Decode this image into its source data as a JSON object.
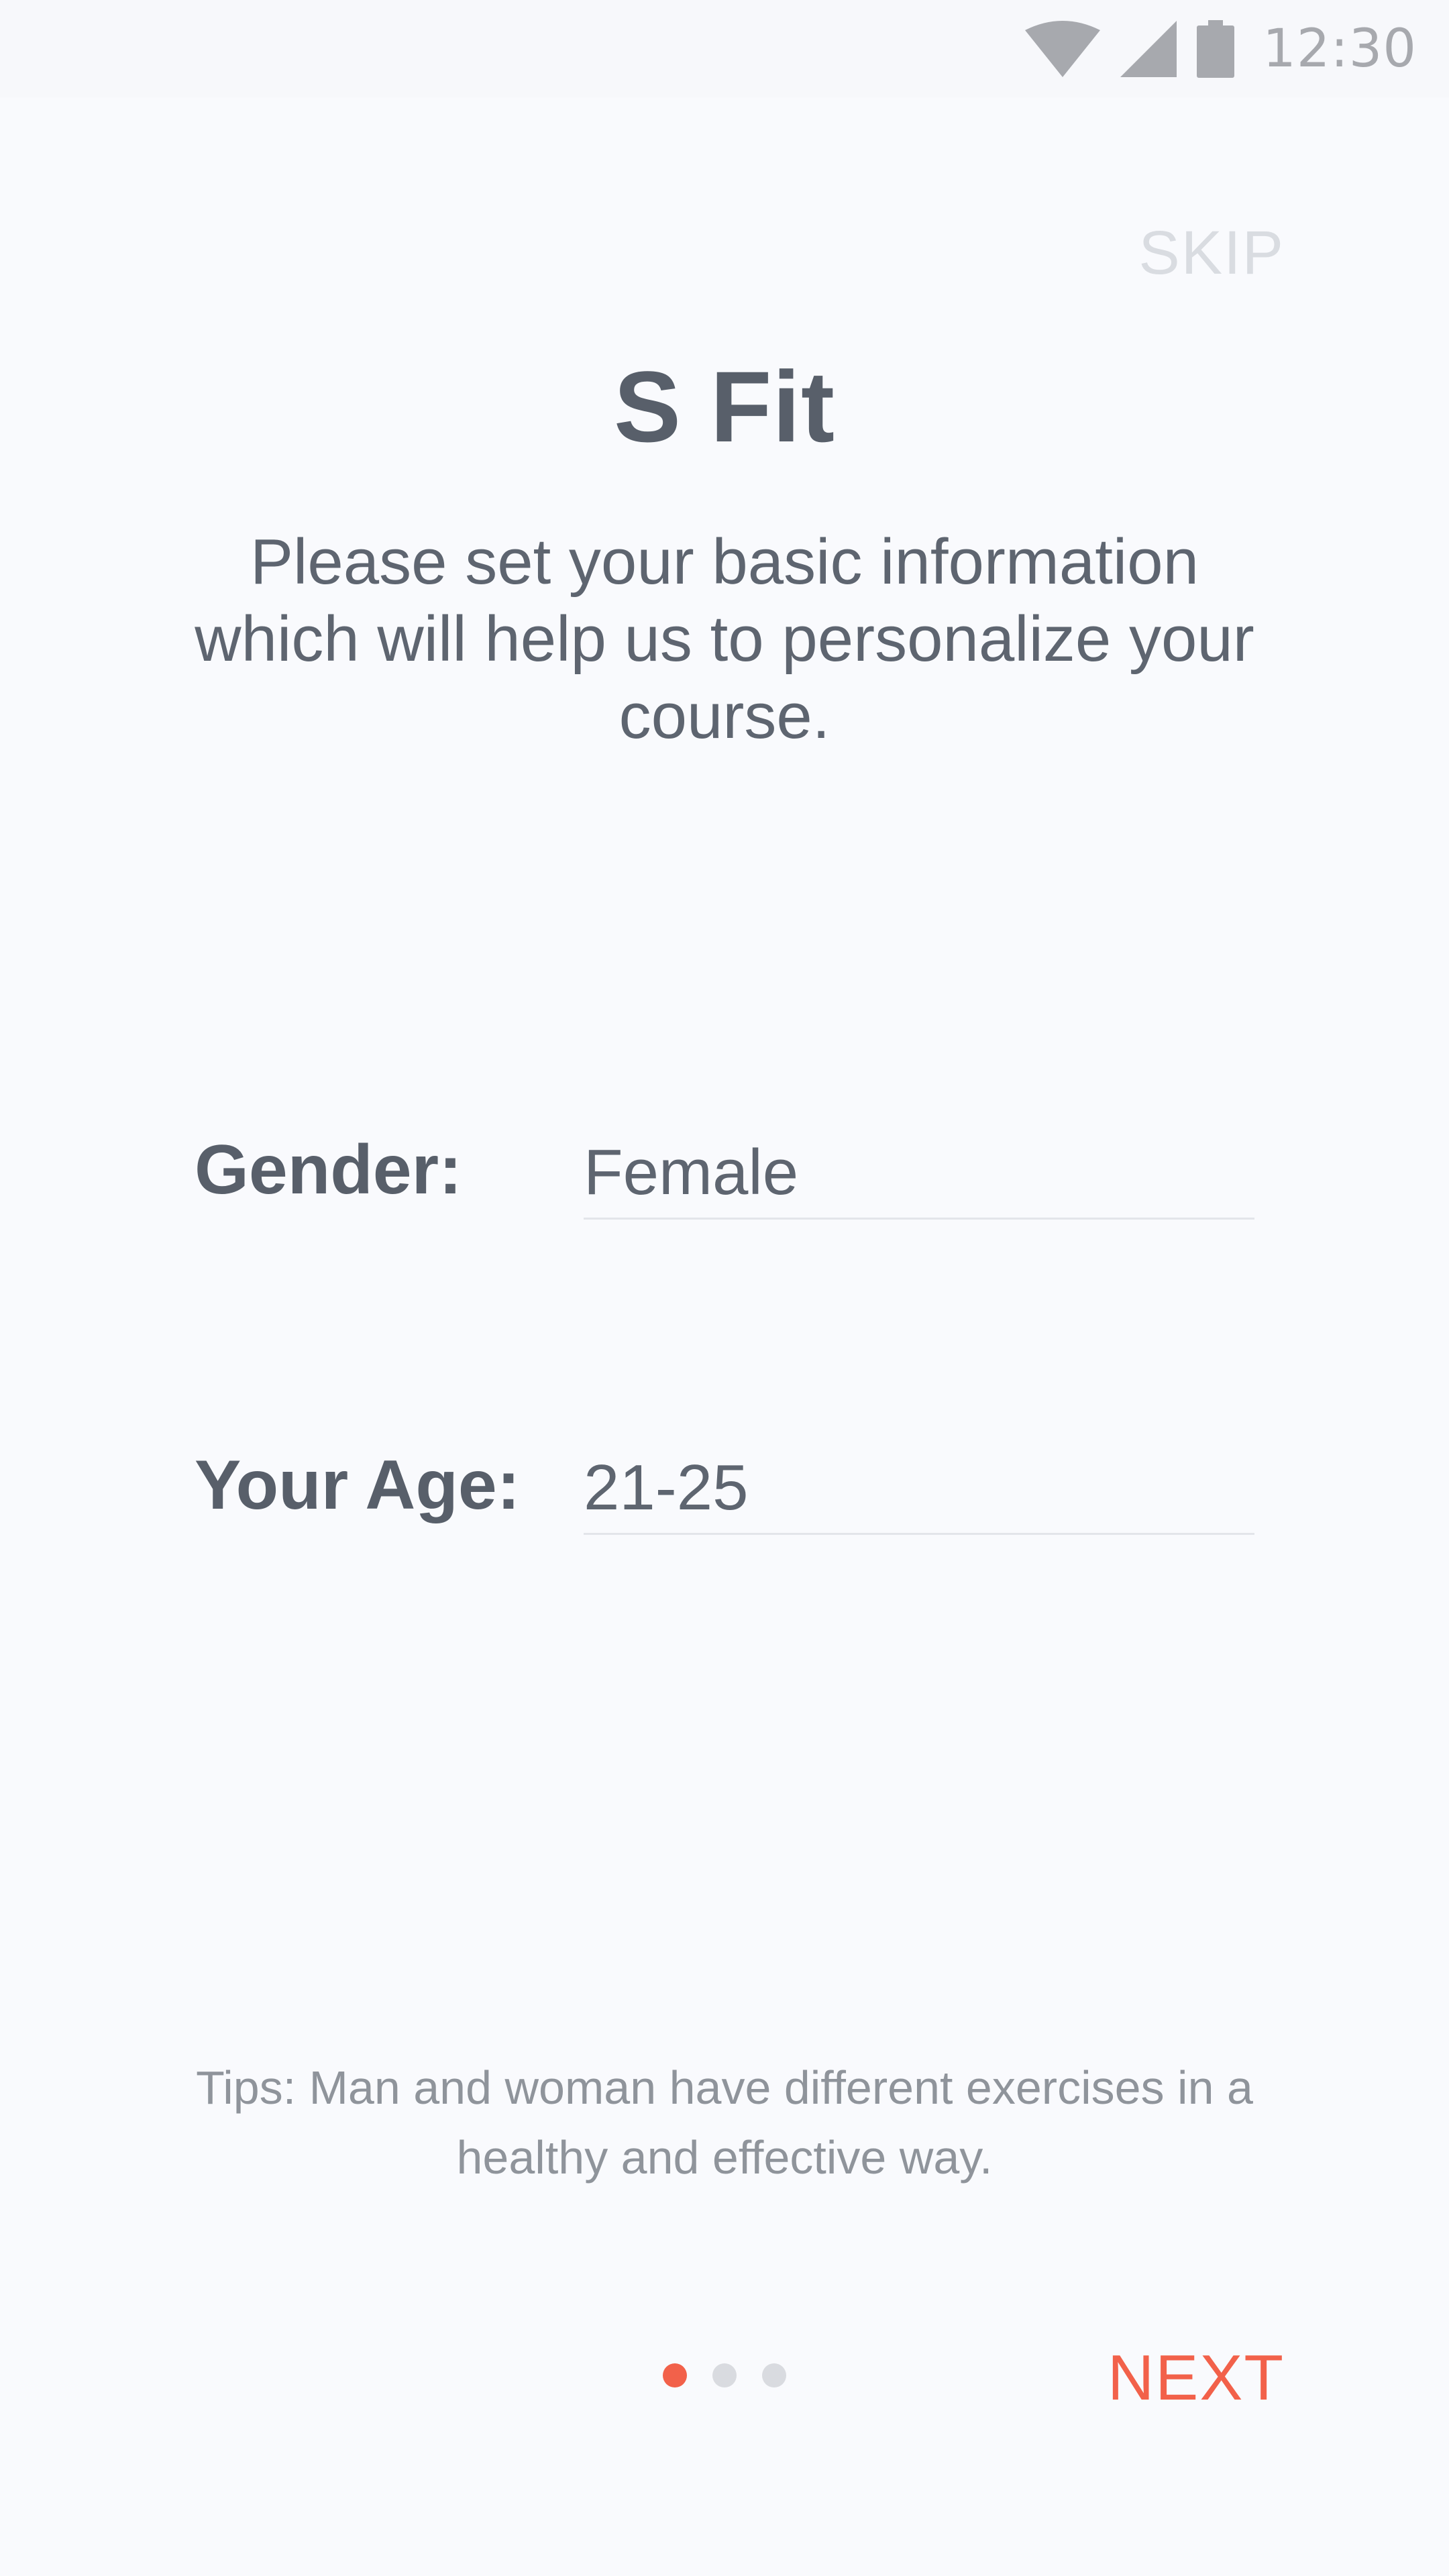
{
  "status_bar": {
    "time": "12:30",
    "icons": [
      "wifi-icon",
      "cell-signal-icon",
      "battery-icon"
    ],
    "icon_color": "#a7a9ae"
  },
  "header": {
    "skip_label": "SKIP",
    "title": "S Fit",
    "subtitle": "Please set your basic information which will help us to personalize your course."
  },
  "form": {
    "gender": {
      "label": "Gender:",
      "value": "Female"
    },
    "age": {
      "label": "Your Age:",
      "value": "21-25"
    }
  },
  "tips": "Tips: Man and woman have different exercises in a healthy and effective way.",
  "footer": {
    "page_indicator": {
      "current": 1,
      "total": 3
    },
    "next_label": "NEXT"
  },
  "colors": {
    "accent": "#f2614a",
    "text_primary": "#585f6a",
    "background": "#f9fafd"
  }
}
